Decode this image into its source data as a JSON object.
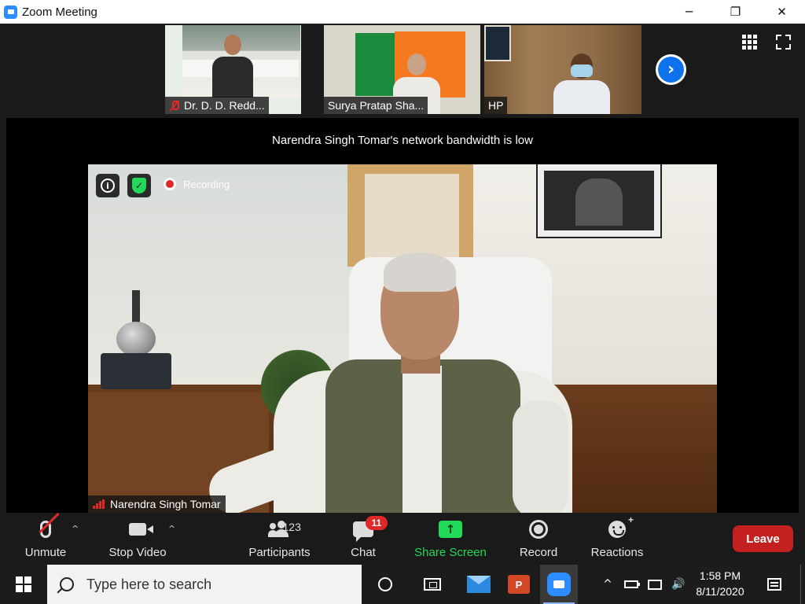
{
  "window": {
    "title": "Zoom Meeting",
    "controls": {
      "minimize": "─",
      "restore": "❐",
      "close": "✕"
    }
  },
  "thumbnails": [
    {
      "name": "Dr. D. D. Redd...",
      "muted": true
    },
    {
      "name": "Surya Pratap Sha...",
      "muted": false
    },
    {
      "name": "HP",
      "muted": false
    }
  ],
  "thumbstrip": {
    "next_icon": "›"
  },
  "stage": {
    "bandwidth_notice": "Narendra Singh Tomar's network bandwidth is low",
    "info_icon": "i",
    "shield_icon": "✓",
    "recording_label": "Recording",
    "speaker_name": "Narendra Singh Tomar"
  },
  "toolbar": {
    "unmute_label": "Unmute",
    "stop_video_label": "Stop Video",
    "participants_label": "Participants",
    "participants_count": "123",
    "chat_label": "Chat",
    "chat_badge": "11",
    "share_label": "Share Screen",
    "share_icon": "↑",
    "record_label": "Record",
    "reactions_label": "Reactions",
    "reactions_plus": "+",
    "leave_label": "Leave",
    "caret": "^"
  },
  "taskbar": {
    "search_placeholder": "Type here to search",
    "time": "1:58 PM",
    "date": "8/11/2020",
    "ppt_letter": "P",
    "tray_chevron": "^",
    "volume_icon": "🔊"
  },
  "colors": {
    "accent_blue": "#0e72ed",
    "share_green": "#23d959",
    "leave_red": "#c42020",
    "badge_red": "#e02828"
  }
}
